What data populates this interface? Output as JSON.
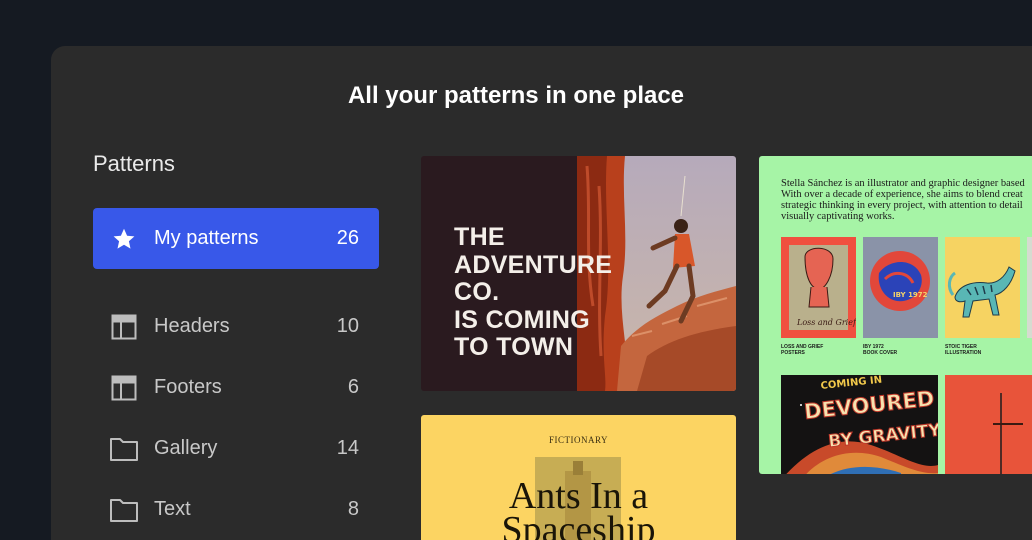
{
  "heading": "All your patterns in one place",
  "sidebar": {
    "title": "Patterns",
    "items": [
      {
        "label": "My patterns",
        "count": "26",
        "icon": "star-icon",
        "active": true
      },
      {
        "label": "Headers",
        "count": "10",
        "icon": "header-layout-icon"
      },
      {
        "label": "Footers",
        "count": "6",
        "icon": "footer-layout-icon"
      },
      {
        "label": "Gallery",
        "count": "14",
        "icon": "folder-icon"
      },
      {
        "label": "Text",
        "count": "8",
        "icon": "folder-icon"
      }
    ]
  },
  "cards": {
    "adventure": {
      "lines": [
        "THE",
        "ADVENTURE",
        "CO.",
        "IS COMING",
        "TO TOWN"
      ]
    },
    "portfolio": {
      "bio_lines": [
        "Stella Sánchez is an illustrator and graphic designer based",
        "With over a decade of experience, she aims to blend creat",
        "strategic thinking in every project, with attention to detail",
        "visually captivating works."
      ],
      "captions": [
        {
          "title": "LOSS AND GRIEF",
          "sub": "POSTERS"
        },
        {
          "title": "IBY 1972",
          "sub": "BOOK COVER"
        },
        {
          "title": "STOIC TIGER",
          "sub": "ILLUSTRATION"
        }
      ],
      "poster_text": {
        "loss": "Loss and Grief",
        "iby": "IBY 1972",
        "devoured": "DEVOURED",
        "gravity": "BY GRAVITY",
        "coming": "COMING IN"
      }
    },
    "ants": {
      "label": "FICTIONARY",
      "title_line1": "Ants In a",
      "title_line2": "Spaceship"
    }
  },
  "colors": {
    "background": "#151a22",
    "panel": "#2b2b2b",
    "accent": "#3858e9",
    "portfolio_bg": "#a6f4a6",
    "ants_bg": "#fcd462"
  }
}
